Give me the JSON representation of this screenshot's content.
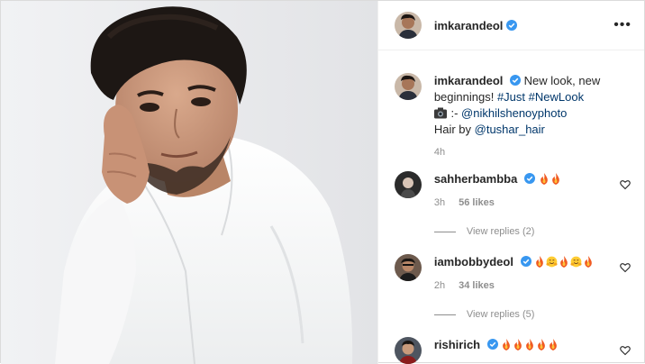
{
  "post": {
    "username": "imkarandeol",
    "more_label": "•••"
  },
  "caption": {
    "username": "imkarandeol",
    "text_1": "New look, new beginnings!",
    "hashtag_1": "#Just",
    "hashtag_2": "#NewLook",
    "camera_prefix": ":-",
    "photo_credit": "@nikhilshenoyphoto",
    "hair_prefix": "Hair by",
    "hair_credit": "@tushar_hair",
    "time": "4h"
  },
  "comments": [
    {
      "username": "sahherbambba",
      "emojis": [
        "fire",
        "fire"
      ],
      "time": "3h",
      "likes": "56 likes",
      "replies": "View replies (2)"
    },
    {
      "username": "iambobbydeol",
      "emojis": [
        "fire",
        "hug",
        "fire",
        "hug",
        "fire"
      ],
      "time": "2h",
      "likes": "34 likes",
      "replies": "View replies (5)"
    },
    {
      "username": "rishirich",
      "emojis": [
        "fire",
        "fire",
        "fire",
        "fire",
        "fire"
      ]
    }
  ],
  "colors": {
    "verified": "#3897f0",
    "link": "#00376b",
    "muted": "#8e8e8e",
    "text": "#262626"
  },
  "icons": {
    "verified": "verified-badge-icon",
    "heart": "heart-outline-icon",
    "camera": "camera-emoji-icon",
    "fire": "fire-emoji-icon",
    "hug": "hugging-face-emoji-icon"
  }
}
